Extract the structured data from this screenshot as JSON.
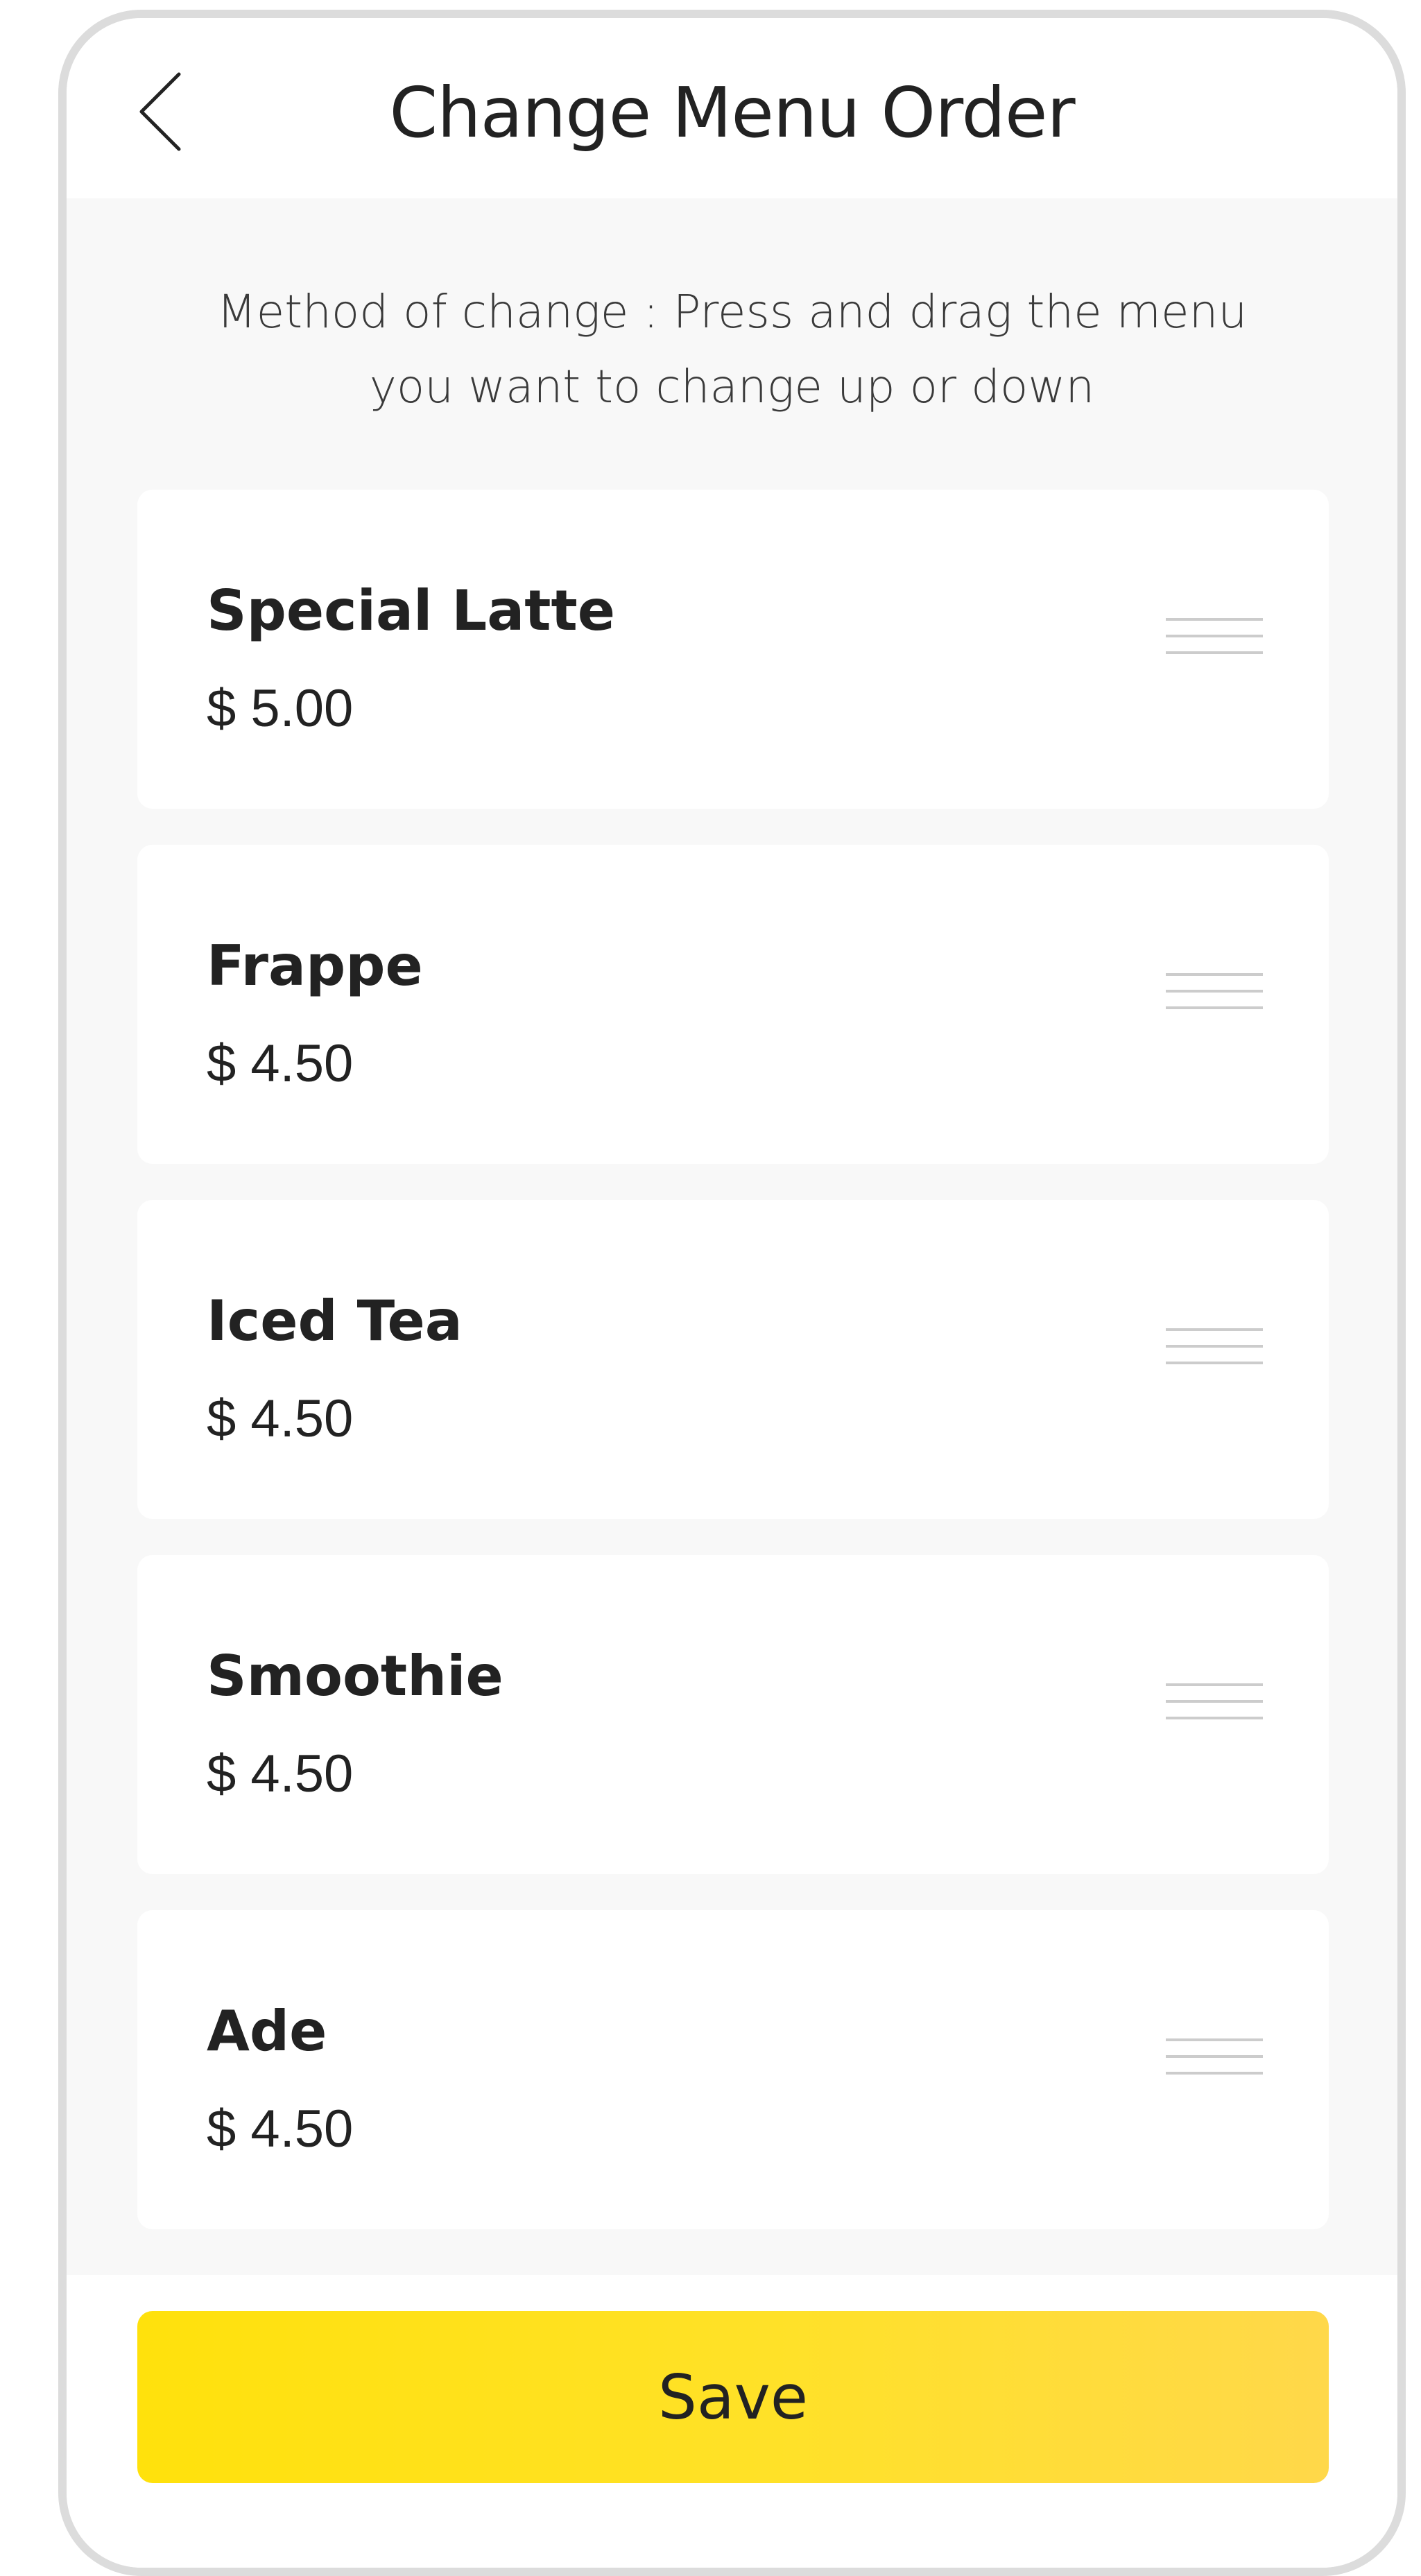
{
  "header": {
    "title": "Change Menu Order",
    "back_icon": "chevron-left-icon"
  },
  "instructions": {
    "line1": "Method of change : Press and drag the menu",
    "line2": "you want to change up or down"
  },
  "menu_items": [
    {
      "name": "Special Latte",
      "price": "$ 5.00"
    },
    {
      "name": "Frappe",
      "price": "$ 4.50"
    },
    {
      "name": "Iced Tea",
      "price": "$ 4.50"
    },
    {
      "name": "Smoothie",
      "price": "$ 4.50"
    },
    {
      "name": "Ade",
      "price": "$ 4.50"
    }
  ],
  "save_button": {
    "label": "Save"
  },
  "colors": {
    "accent": "#FFE10C",
    "background": "#F8F8F8",
    "card": "#FFFFFF",
    "text": "#222222",
    "handle": "#CCCCCC",
    "frame": "#DCDCDC"
  }
}
